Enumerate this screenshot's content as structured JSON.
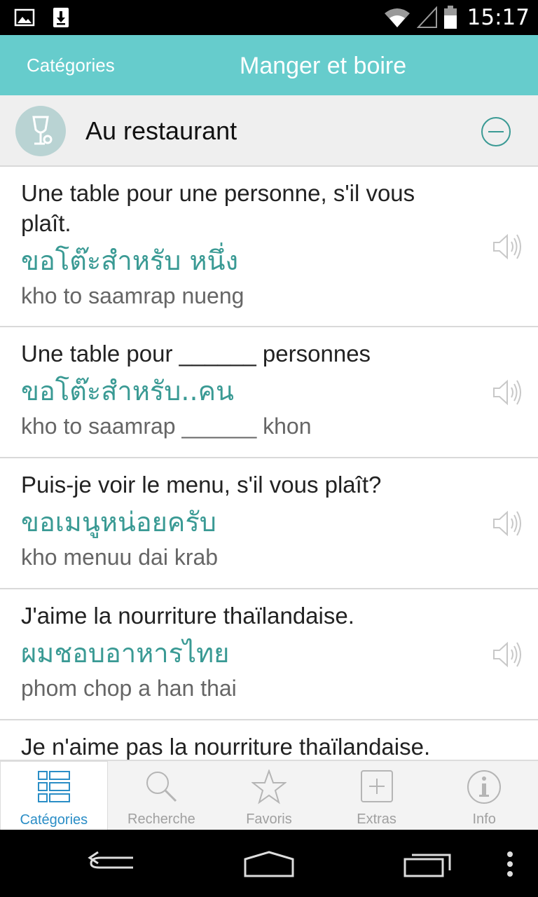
{
  "status_bar": {
    "time": "15:17",
    "icons": [
      "image-notification-icon",
      "download-icon",
      "wifi-icon",
      "signal-icon",
      "battery-icon"
    ]
  },
  "action_bar": {
    "back_label": "Catégories",
    "title": "Manger et boire"
  },
  "category": {
    "title": "Au restaurant",
    "icon": "wine-glass-icon",
    "toggle_icon": "collapse-minus-icon"
  },
  "phrases": [
    {
      "fr": "Une table pour une personne, s'il vous plaît.",
      "th": "ขอโต๊ะสำหรับ หนึ่ง",
      "tr": "kho to saamrap nueng"
    },
    {
      "fr": "Une table pour ______ personnes",
      "th": "ขอโต๊ะสำหรับ..คน",
      "tr": "kho to saamrap ______ khon"
    },
    {
      "fr": "Puis-je voir le menu, s'il vous plaît?",
      "th": "ขอเมนูหน่อยครับ",
      "tr": "kho menuu dai krab"
    },
    {
      "fr": "J'aime la nourriture thaïlandaise.",
      "th": "ผมชอบอาหารไทย",
      "tr": "phom chop a han thai"
    },
    {
      "fr": "Je n'aime pas la nourriture thaïlandaise.",
      "th": "",
      "tr": ""
    }
  ],
  "tabs": [
    {
      "label": "Catégories",
      "icon": "categories-list-icon",
      "active": true
    },
    {
      "label": "Recherche",
      "icon": "search-icon",
      "active": false
    },
    {
      "label": "Favoris",
      "icon": "star-icon",
      "active": false
    },
    {
      "label": "Extras",
      "icon": "plus-box-icon",
      "active": false
    },
    {
      "label": "Info",
      "icon": "info-icon",
      "active": false
    }
  ],
  "colors": {
    "accent": "#66cccc",
    "thai_text": "#3a9a94",
    "active_tab": "#2a8dc6"
  }
}
